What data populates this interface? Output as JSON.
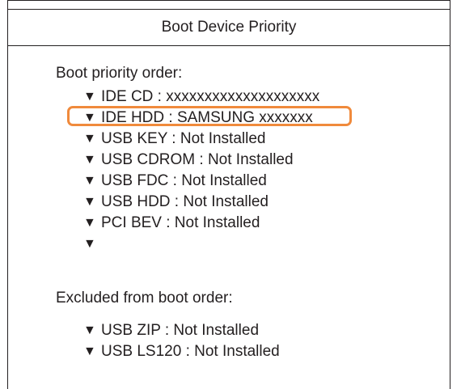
{
  "title": "Boot Device Priority",
  "priority_section": {
    "label": "Boot priority order:",
    "items": [
      {
        "arrow": "▼",
        "label": "IDE CD : xxxxxxxxxxxxxxxxxxxx"
      },
      {
        "arrow": "▼",
        "label": "IDE HDD : SAMSUNG xxxxxxx"
      },
      {
        "arrow": "▼",
        "label": "USB KEY : Not Installed"
      },
      {
        "arrow": "▼",
        "label": "USB CDROM : Not Installed"
      },
      {
        "arrow": "▼",
        "label": "USB FDC : Not Installed"
      },
      {
        "arrow": "▼",
        "label": "USB HDD : Not Installed"
      },
      {
        "arrow": "▼",
        "label": "PCI BEV : Not Installed"
      },
      {
        "arrow": "▼",
        "label": ""
      }
    ]
  },
  "excluded_section": {
    "label": "Excluded from boot order:",
    "items": [
      {
        "arrow": "▼",
        "label": "USB ZIP : Not Installed"
      },
      {
        "arrow": "▼",
        "label": "USB LS120 : Not Installed"
      }
    ]
  },
  "colors": {
    "highlight": "#f08a3c",
    "text": "#231f20",
    "border": "#231f20"
  }
}
